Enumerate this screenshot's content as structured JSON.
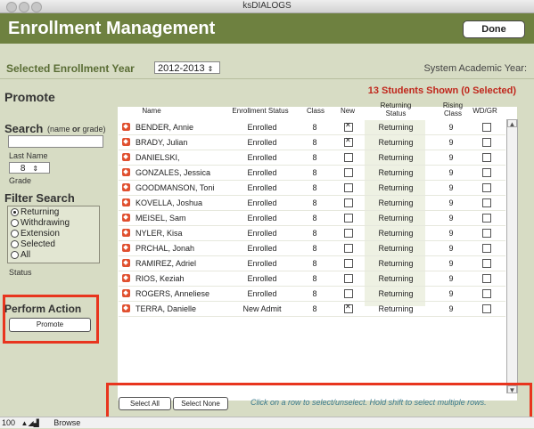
{
  "window": {
    "title": "ksDIALOGS"
  },
  "header": {
    "title": "Enrollment Management",
    "done_label": "Done"
  },
  "year": {
    "label": "Selected Enrollment Year",
    "value": "2012-2013",
    "system_label": "System Academic Year:"
  },
  "promote": {
    "title": "Promote",
    "students_shown": "13 Students Shown (0 Selected)"
  },
  "search": {
    "label": "Search",
    "hint_pre": "(name ",
    "hint_or": "or",
    "hint_post": " grade)",
    "lastname_label": "Last Name",
    "grade_value": "8",
    "grade_label": "Grade"
  },
  "filter": {
    "label": "Filter Search",
    "options": [
      "Returning",
      "Withdrawing",
      "Extension",
      "Selected",
      "All"
    ],
    "selected": "Returning",
    "status_label": "Status"
  },
  "action": {
    "title": "Perform Action",
    "promote_label": "Promote"
  },
  "table": {
    "columns": {
      "name": "Name",
      "enrollment_status": "Enrollment Status",
      "class": "Class",
      "new": "New",
      "returning_status_1": "Returning",
      "returning_status_2": "Status",
      "rising_class_1": "Rising",
      "rising_class_2": "Class",
      "wdgr": "WD/GR"
    },
    "rows": [
      {
        "name": "BENDER, Annie",
        "status": "Enrolled",
        "class": "8",
        "new": true,
        "returning": "Returning",
        "rising": "9",
        "wdgr": false
      },
      {
        "name": "BRADY, Julian",
        "status": "Enrolled",
        "class": "8",
        "new": true,
        "returning": "Returning",
        "rising": "9",
        "wdgr": false
      },
      {
        "name": "DANIELSKI,",
        "status": "Enrolled",
        "class": "8",
        "new": false,
        "returning": "Returning",
        "rising": "9",
        "wdgr": false
      },
      {
        "name": "GONZALES, Jessica",
        "status": "Enrolled",
        "class": "8",
        "new": false,
        "returning": "Returning",
        "rising": "9",
        "wdgr": false
      },
      {
        "name": "GOODMANSON, Toni",
        "status": "Enrolled",
        "class": "8",
        "new": false,
        "returning": "Returning",
        "rising": "9",
        "wdgr": false
      },
      {
        "name": "KOVELLA, Joshua",
        "status": "Enrolled",
        "class": "8",
        "new": false,
        "returning": "Returning",
        "rising": "9",
        "wdgr": false
      },
      {
        "name": "MEISEL, Sam",
        "status": "Enrolled",
        "class": "8",
        "new": false,
        "returning": "Returning",
        "rising": "9",
        "wdgr": false
      },
      {
        "name": "NYLER, Kisa",
        "status": "Enrolled",
        "class": "8",
        "new": false,
        "returning": "Returning",
        "rising": "9",
        "wdgr": false
      },
      {
        "name": "PRCHAL, Jonah",
        "status": "Enrolled",
        "class": "8",
        "new": false,
        "returning": "Returning",
        "rising": "9",
        "wdgr": false
      },
      {
        "name": "RAMIREZ, Adriel",
        "status": "Enrolled",
        "class": "8",
        "new": false,
        "returning": "Returning",
        "rising": "9",
        "wdgr": false
      },
      {
        "name": "RIOS, Keziah",
        "status": "Enrolled",
        "class": "8",
        "new": false,
        "returning": "Returning",
        "rising": "9",
        "wdgr": false
      },
      {
        "name": "ROGERS, Anneliese",
        "status": "Enrolled",
        "class": "8",
        "new": false,
        "returning": "Returning",
        "rising": "9",
        "wdgr": false
      },
      {
        "name": "TERRA, Danielle",
        "status": "New Admit",
        "class": "8",
        "new": true,
        "returning": "Returning",
        "rising": "9",
        "wdgr": false
      }
    ]
  },
  "footer": {
    "select_all": "Select All",
    "select_none": "Select None",
    "hint": "Click on a row to select/unselect. Hold shift to select multiple rows."
  },
  "statusbar": {
    "zoom": "100",
    "mode": "Browse"
  }
}
